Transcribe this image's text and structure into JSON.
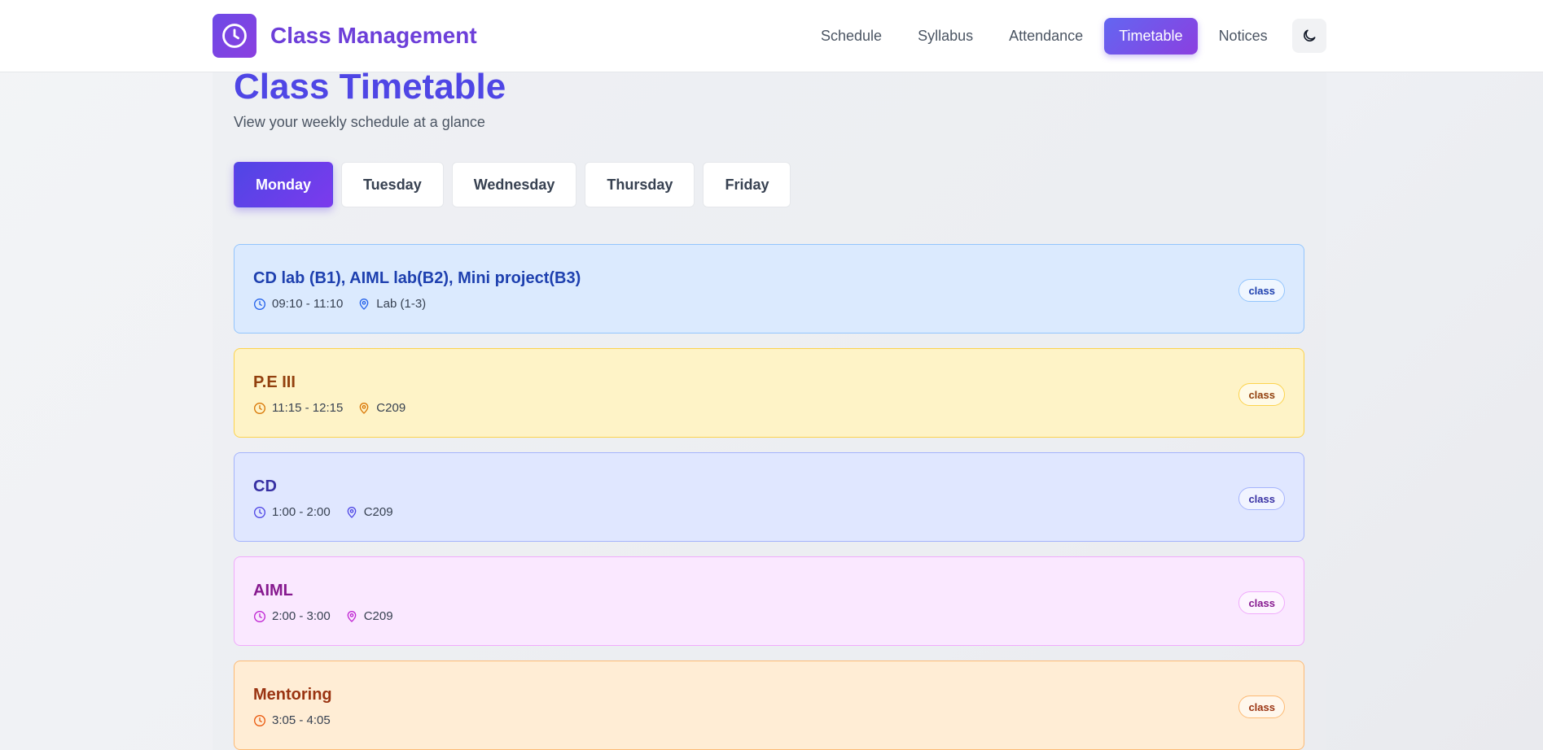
{
  "app": {
    "brand": "Class Management"
  },
  "nav": {
    "items": [
      {
        "label": "Schedule"
      },
      {
        "label": "Syllabus"
      },
      {
        "label": "Attendance"
      },
      {
        "label": "Timetable",
        "active": true
      },
      {
        "label": "Notices"
      }
    ],
    "theme_toggle_icon": "moon-icon"
  },
  "page": {
    "title": "Class Timetable",
    "subtitle": "View your weekly schedule at a glance"
  },
  "days": [
    {
      "label": "Monday",
      "active": true
    },
    {
      "label": "Tuesday"
    },
    {
      "label": "Wednesday"
    },
    {
      "label": "Thursday"
    },
    {
      "label": "Friday"
    }
  ],
  "classes": [
    {
      "title": "CD lab (B1), AIML lab(B2), Mini project(B3)",
      "time": "09:10 - 11:10",
      "location": "Lab (1-3)",
      "badge": "class",
      "bg": "#dbeafe",
      "border": "#93c5fd",
      "accent": "#1e40af",
      "icon": "#2563eb"
    },
    {
      "title": "P.E III",
      "time": "11:15 - 12:15",
      "location": "C209",
      "badge": "class",
      "bg": "#fef3c7",
      "border": "#fcd34d",
      "accent": "#92400e",
      "icon": "#d97706"
    },
    {
      "title": "CD",
      "time": "1:00 - 2:00",
      "location": "C209",
      "badge": "class",
      "bg": "#e0e7ff",
      "border": "#a5b4fc",
      "accent": "#3730a3",
      "icon": "#4f46e5"
    },
    {
      "title": "AIML",
      "time": "2:00 - 3:00",
      "location": "C209",
      "badge": "class",
      "bg": "#fae8ff",
      "border": "#f0abfc",
      "accent": "#86198f",
      "icon": "#c026d3"
    },
    {
      "title": "Mentoring",
      "time": "3:05 - 4:05",
      "location": "",
      "badge": "class",
      "bg": "#ffedd5",
      "border": "#fdba74",
      "accent": "#9a3412",
      "icon": "#ea580c"
    }
  ]
}
